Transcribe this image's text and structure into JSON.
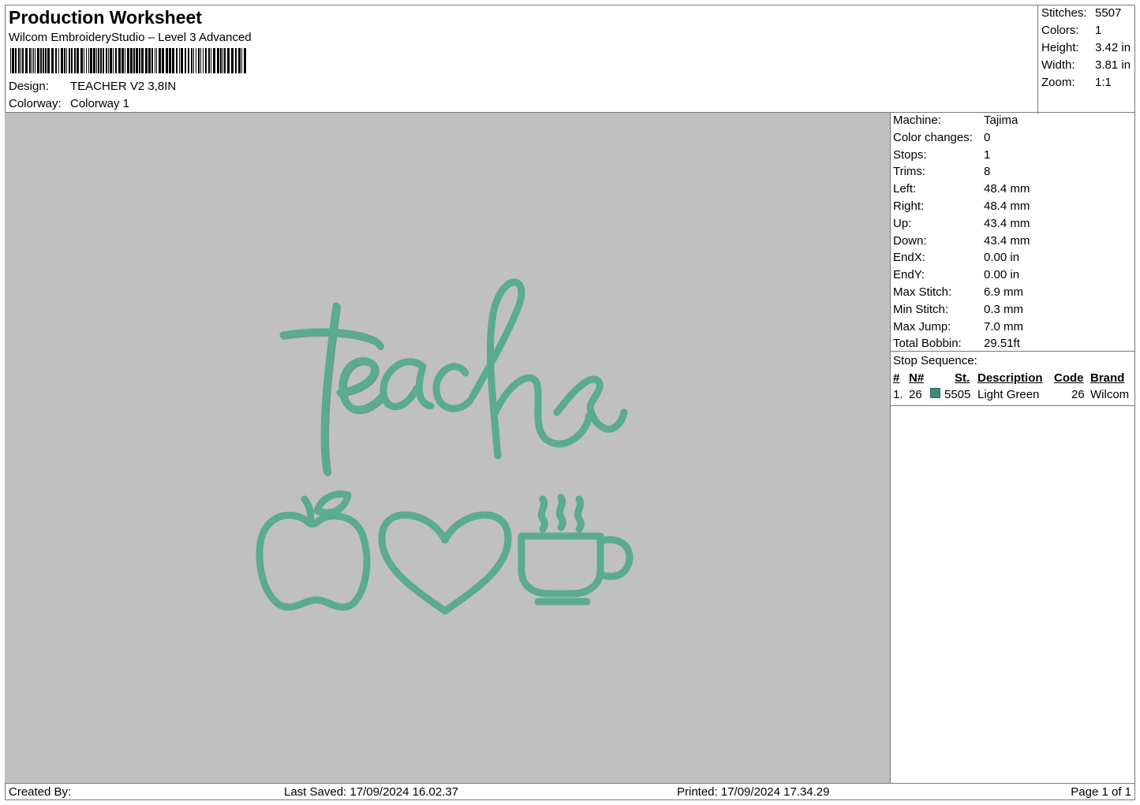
{
  "header": {
    "title": "Production Worksheet",
    "subtitle": "Wilcom EmbroideryStudio – Level 3 Advanced",
    "design_label": "Design:",
    "design_value": "TEACHER V2 3,8IN",
    "colorway_label": "Colorway:",
    "colorway_value": "Colorway 1"
  },
  "summary": {
    "stitches_label": "Stitches:",
    "stitches": "5507",
    "colors_label": "Colors:",
    "colors": "1",
    "height_label": "Height:",
    "height": "3.42 in",
    "width_label": "Width:",
    "width": "3.81 in",
    "zoom_label": "Zoom:",
    "zoom": "1:1"
  },
  "machine_info": [
    {
      "label": "Machine:",
      "value": "Tajima"
    },
    {
      "label": "Color changes:",
      "value": "0"
    },
    {
      "label": "Stops:",
      "value": "1"
    },
    {
      "label": "Trims:",
      "value": "8"
    },
    {
      "label": "Left:",
      "value": "48.4 mm"
    },
    {
      "label": "Right:",
      "value": "48.4 mm"
    },
    {
      "label": "Up:",
      "value": "43.4 mm"
    },
    {
      "label": "Down:",
      "value": "43.4 mm"
    },
    {
      "label": "EndX:",
      "value": "0.00 in"
    },
    {
      "label": "EndY:",
      "value": "0.00 in"
    },
    {
      "label": "Max Stitch:",
      "value": "6.9 mm"
    },
    {
      "label": "Min Stitch:",
      "value": "0.3 mm"
    },
    {
      "label": "Max Jump:",
      "value": "7.0 mm"
    },
    {
      "label": "Total Bobbin:",
      "value": "29.51ft"
    }
  ],
  "stop_sequence": {
    "title": "Stop Sequence:",
    "headers": {
      "num": "#",
      "n": "N#",
      "st": "St.",
      "description": "Description",
      "code": "Code",
      "brand": "Brand"
    },
    "rows": [
      {
        "num": "1.",
        "n": "26",
        "st": "5505",
        "description": "Light Green",
        "code": "26",
        "brand": "Wilcom",
        "color": "#3d8b78"
      }
    ]
  },
  "design": {
    "text": "teacher",
    "thread_color": "#5aab92",
    "icons": [
      "apple-icon",
      "heart-icon",
      "coffee-cup-icon"
    ]
  },
  "footer": {
    "created_by": "Created By:",
    "last_saved": "Last Saved: 17/09/2024 16.02.37",
    "printed": "Printed: 17/09/2024 17.34.29",
    "page": "Page 1 of 1"
  }
}
